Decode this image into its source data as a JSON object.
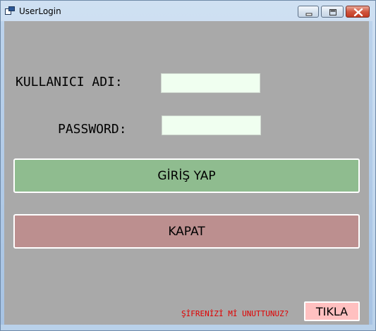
{
  "window": {
    "title": "UserLogin",
    "icon": "window-app-icon",
    "controls": [
      "minimize-icon",
      "maximize-icon",
      "close-icon"
    ]
  },
  "form": {
    "username_label": "KULLANICI ADI:",
    "username_value": "",
    "password_label": "PASSWORD:",
    "password_value": "",
    "login_button": "GİRİŞ YAP",
    "close_button": "KAPAT",
    "forgot_text": "ŞİFRENİZİ Mİ UNUTTUNUZ?",
    "click_button": "TIKLA"
  },
  "colors": {
    "client_background": "#a9a9a9",
    "input_background": "#f0fff0",
    "login_button": "#8fbc8f",
    "close_button": "#bc8f8f",
    "click_button": "#ffc0c0",
    "forgot_text": "#e00000"
  }
}
